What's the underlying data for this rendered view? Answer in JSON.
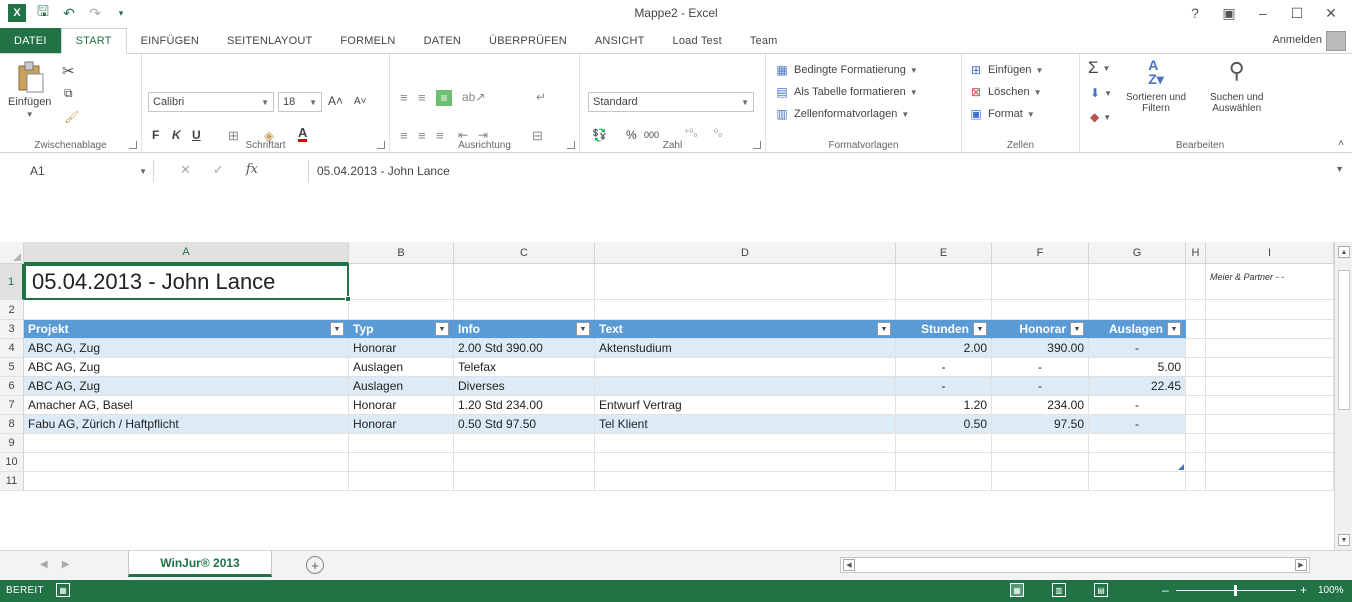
{
  "window": {
    "title": "Mappe2 - Excel",
    "help": "?",
    "options": "▣",
    "minimize": "–",
    "maximize": "☐",
    "close": "✕"
  },
  "qat": {
    "logo": "X",
    "save": "🖫",
    "undo": "↶",
    "redo": "↷",
    "customize": "▾"
  },
  "tabs": [
    {
      "label": "DATEI"
    },
    {
      "label": "START"
    },
    {
      "label": "EINFÜGEN"
    },
    {
      "label": "SEITENLAYOUT"
    },
    {
      "label": "FORMELN"
    },
    {
      "label": "DATEN"
    },
    {
      "label": "ÜBERPRÜFEN"
    },
    {
      "label": "ANSICHT"
    },
    {
      "label": "Load Test"
    },
    {
      "label": "Team"
    }
  ],
  "signin": "Anmelden",
  "ribbon": {
    "clipboard": {
      "label": "Zwischenablage",
      "paste": "Einfügen"
    },
    "font": {
      "label": "Schriftart",
      "name": "Calibri",
      "size": "18",
      "bold": "F",
      "italic": "K",
      "underline": "U",
      "grow": "A˄",
      "shrink": "A˅"
    },
    "alignment": {
      "label": "Ausrichtung"
    },
    "number": {
      "label": "Zahl",
      "format": "Standard",
      "percent": "%",
      "thousands": "000",
      "inc": "⁺⁰₀",
      "dec": "⁰₀"
    },
    "styles": {
      "label": "Formatvorlagen",
      "conditional": "Bedingte Formatierung",
      "as_table": "Als Tabelle formatieren",
      "cell_styles": "Zellenformatvorlagen"
    },
    "cells": {
      "label": "Zellen",
      "insert": "Einfügen",
      "delete": "Löschen",
      "format": "Format"
    },
    "editing": {
      "label": "Bearbeiten",
      "sort_line1": "Sortieren und",
      "sort_line2": "Filtern",
      "find_line1": "Suchen und",
      "find_line2": "Auswählen"
    }
  },
  "formula_bar": {
    "namebox": "A1",
    "fx": "fx",
    "cancel": "✕",
    "enter": "✓",
    "content": "05.04.2013 - John Lance"
  },
  "columns": [
    "A",
    "B",
    "C",
    "D",
    "E",
    "F",
    "G",
    "H",
    "I"
  ],
  "rows": [
    "1",
    "2",
    "3",
    "4",
    "5",
    "6",
    "7",
    "8",
    "9",
    "10",
    "11"
  ],
  "sheet": {
    "title": "05.04.2013 - John Lance",
    "overflow_text": "Meier & Partner - -",
    "headers": [
      "Projekt",
      "Typ",
      "Info",
      "Text",
      "Stunden",
      "Honorar",
      "Auslagen"
    ],
    "data": [
      [
        "ABC AG, Zug",
        "Honorar",
        "2.00 Std 390.00",
        "Aktenstudium",
        "2.00",
        "390.00",
        "-"
      ],
      [
        "ABC AG, Zug",
        "Auslagen",
        "Telefax",
        "",
        "-",
        "-",
        "5.00"
      ],
      [
        "ABC AG, Zug",
        "Auslagen",
        "Diverses",
        "",
        "-",
        "-",
        "22.45"
      ],
      [
        "Amacher AG, Basel",
        "Honorar",
        "1.20 Std 234.00",
        "Entwurf Vertrag",
        "1.20",
        "234.00",
        "-"
      ],
      [
        "Fabu AG, Zürich / Haftpflicht",
        "Honorar",
        "0.50 Std 97.50",
        "Tel Klient",
        "0.50",
        "97.50",
        "-"
      ]
    ]
  },
  "sheet_tabs": [
    {
      "label": "WinJur® 2013"
    }
  ],
  "add_sheet": "+",
  "status": {
    "text": "BEREIT",
    "zoom": "100%",
    "minus": "–",
    "plus": "+"
  },
  "colors": {
    "accent": "#217346",
    "table_header": "#5b9bd5",
    "table_band": "#ddebf7"
  }
}
